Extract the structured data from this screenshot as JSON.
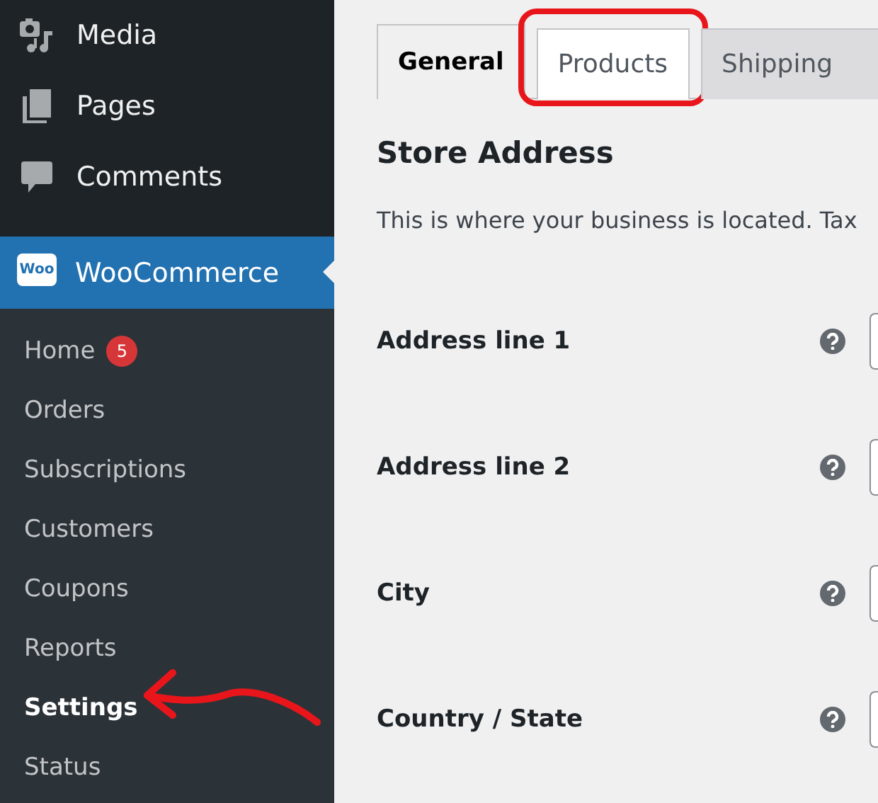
{
  "sidebar": {
    "menu": [
      {
        "label": "Media",
        "kind": "media"
      },
      {
        "label": "Pages",
        "kind": "pages"
      },
      {
        "label": "Comments",
        "kind": "comments"
      }
    ],
    "active_menu": {
      "label": "WooCommerce",
      "logo_text": "Woo"
    },
    "submenu": [
      {
        "label": "Home",
        "badge": "5",
        "selected": false,
        "arrow": false
      },
      {
        "label": "Orders",
        "selected": false,
        "arrow": false
      },
      {
        "label": "Subscriptions",
        "selected": false,
        "arrow": false
      },
      {
        "label": "Customers",
        "selected": false,
        "arrow": false
      },
      {
        "label": "Coupons",
        "selected": false,
        "arrow": false
      },
      {
        "label": "Reports",
        "selected": false,
        "arrow": false
      },
      {
        "label": "Settings",
        "selected": true,
        "arrow": true
      },
      {
        "label": "Status",
        "selected": false,
        "arrow": false
      }
    ]
  },
  "tabs": [
    {
      "label": "General",
      "selected": true,
      "highlighted": false
    },
    {
      "label": "Products",
      "selected": false,
      "highlighted": true
    },
    {
      "label": "Shipping",
      "selected": false,
      "highlighted": false
    }
  ],
  "section": {
    "title": "Store Address",
    "description": "This is where your business is located. Tax"
  },
  "fields": [
    {
      "label": "Address line 1"
    },
    {
      "label": "Address line 2"
    },
    {
      "label": "City"
    },
    {
      "label": "Country / State"
    }
  ]
}
